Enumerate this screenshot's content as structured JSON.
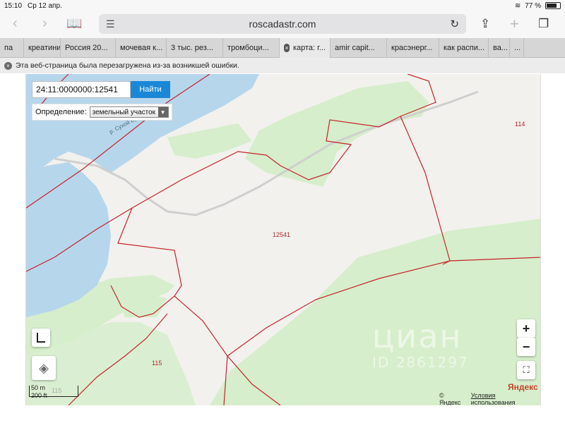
{
  "status_bar": {
    "time": "15:10",
    "date": "Ср 12 апр.",
    "battery": "77 %",
    "battery_level": 0.77
  },
  "browser": {
    "url": "roscadastr.com",
    "tabs": [
      {
        "label": "па",
        "active": false
      },
      {
        "label": "креатинин",
        "active": false
      },
      {
        "label": "Россия 20...",
        "active": false
      },
      {
        "label": "мочевая к...",
        "active": false
      },
      {
        "label": "3 тыс. рез...",
        "active": false
      },
      {
        "label": "тромбоци...",
        "active": false
      },
      {
        "label": "карта: г...",
        "active": true
      },
      {
        "label": "amir capit...",
        "active": false
      },
      {
        "label": "красэнерг...",
        "active": false
      },
      {
        "label": "как распи...",
        "active": false
      },
      {
        "label": "ва...",
        "active": false
      },
      {
        "label": "...",
        "active": false
      }
    ],
    "banner": "Эта веб-страница была перезагружена из-за возникшей ошибки."
  },
  "map": {
    "search_value": "24:11:0000000:12541",
    "search_button": "Найти",
    "definition_label": "Определение:",
    "definition_value": "земельный участок",
    "river_label": "р. Сухой Бузим",
    "plots": {
      "main": "12541",
      "east": "114",
      "southwest": "115",
      "small": "115"
    },
    "zoom_in": "+",
    "zoom_out": "−",
    "scale": {
      "metric": "50 m",
      "imperial": "200 ft"
    },
    "attribution": "© Яндекс",
    "terms": "Условия использования",
    "yandex": "Яндекс",
    "watermark": "циан",
    "watermark_id": "ID 2861297"
  },
  "colors": {
    "water": "#b6d6ec",
    "forest": "#d6eecb",
    "boundary": "#c5232a",
    "search_button": "#1a88d6"
  }
}
